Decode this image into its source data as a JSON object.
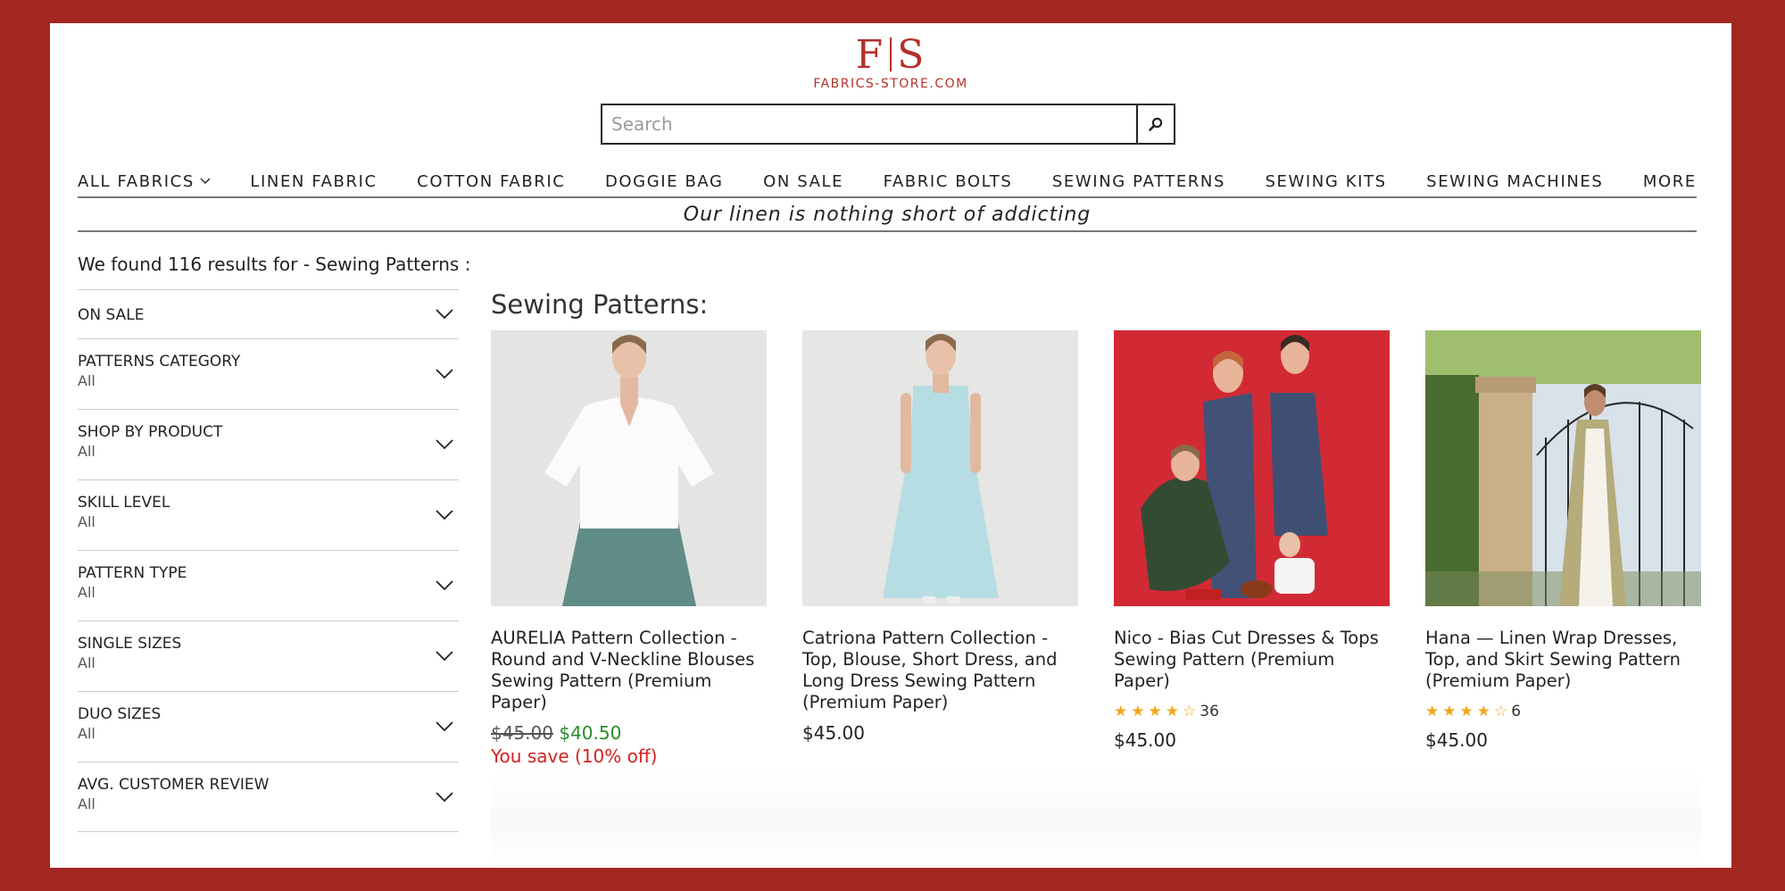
{
  "logo": {
    "mark_left": "F",
    "mark_right": "S",
    "text": "FABRICS-STORE.COM"
  },
  "search": {
    "placeholder": "Search",
    "icon": "search-icon"
  },
  "nav": [
    {
      "label": "ALL FABRICS",
      "has_dropdown": true
    },
    {
      "label": "LINEN FABRIC"
    },
    {
      "label": "COTTON FABRIC"
    },
    {
      "label": "DOGGIE BAG"
    },
    {
      "label": "ON SALE"
    },
    {
      "label": "FABRIC BOLTS"
    },
    {
      "label": "SEWING PATTERNS"
    },
    {
      "label": "SEWING KITS"
    },
    {
      "label": "SEWING MACHINES"
    },
    {
      "label": "MORE"
    }
  ],
  "tagline": "Our linen is nothing short of addicting",
  "results_text": "We found 116 results for - Sewing Patterns :",
  "filters": [
    {
      "label": "ON SALE",
      "value": ""
    },
    {
      "label": "PATTERNS CATEGORY",
      "value": "All"
    },
    {
      "label": "SHOP BY PRODUCT",
      "value": "All"
    },
    {
      "label": "SKILL LEVEL",
      "value": "All"
    },
    {
      "label": "PATTERN TYPE",
      "value": "All"
    },
    {
      "label": "SINGLE SIZES",
      "value": "All"
    },
    {
      "label": "DUO SIZES",
      "value": "All"
    },
    {
      "label": "AVG. CUSTOMER REVIEW",
      "value": "All"
    }
  ],
  "section_title": "Sewing Patterns:",
  "products": [
    {
      "title": "AURELIA Pattern Collection - Round and V-Neckline Blouses Sewing Pattern (Premium Paper)",
      "old_price": "$45.00",
      "new_price": "$40.50",
      "save": "You save (10% off)"
    },
    {
      "title": "Catriona Pattern Collection - Top, Blouse, Short Dress, and Long Dress Sewing Pattern (Premium Paper)",
      "price": "$45.00"
    },
    {
      "title": "Nico - Bias Cut Dresses & Tops Sewing Pattern (Premium Paper)",
      "rating": 3.5,
      "reviews": "36",
      "price": "$45.00"
    },
    {
      "title": "Hana — Linen Wrap Dresses, Top, and Skirt Sewing Pattern (Premium Paper)",
      "rating": 3.5,
      "reviews": "6",
      "price": "$45.00"
    }
  ],
  "colors": {
    "brand": "#b3312a",
    "background": "#a42620",
    "sale_green": "#2a8a2a",
    "sale_red": "#d42020",
    "star": "#f4a51c"
  }
}
